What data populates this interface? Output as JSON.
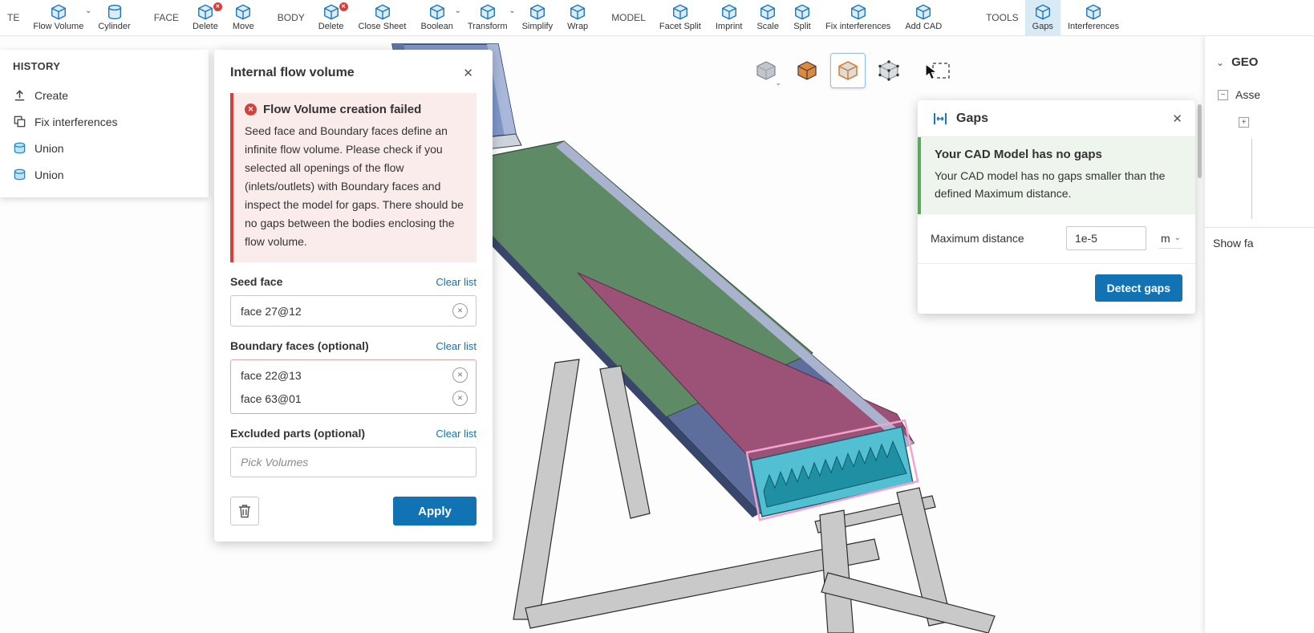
{
  "colors": {
    "accent": "#1173b4",
    "toolbar_icon_blue": "#1a76b8",
    "error_red": "#d4403a",
    "error_bg": "#fbecec",
    "success_green": "#5ba75d",
    "success_bg": "#edf5ec",
    "selected_tool_bg": "#d9eaf7"
  },
  "icons": {
    "close": "✕",
    "chevron_down": "⌄",
    "minus": "−",
    "plus": "+",
    "badge_x": "✕"
  },
  "toolbar": {
    "groups": [
      {
        "label": "TE",
        "items": [
          {
            "label": "Flow Volume"
          },
          {
            "label": "Cylinder"
          }
        ]
      },
      {
        "label": "FACE",
        "items": [
          {
            "label": "Delete"
          },
          {
            "label": "Move"
          }
        ]
      },
      {
        "label": "BODY",
        "items": [
          {
            "label": "Delete"
          },
          {
            "label": "Close Sheet"
          },
          {
            "label": "Boolean"
          },
          {
            "label": "Transform"
          },
          {
            "label": "Simplify"
          },
          {
            "label": "Wrap"
          }
        ]
      },
      {
        "label": "MODEL",
        "items": [
          {
            "label": "Facet Split"
          },
          {
            "label": "Imprint"
          },
          {
            "label": "Scale"
          },
          {
            "label": "Split"
          },
          {
            "label": "Fix interferences"
          },
          {
            "label": "Add CAD"
          }
        ]
      },
      {
        "label": "TOOLS",
        "items": [
          {
            "label": "Gaps"
          },
          {
            "label": "Interferences"
          }
        ]
      }
    ]
  },
  "history": {
    "title": "HISTORY",
    "items": [
      {
        "label": "Create"
      },
      {
        "label": "Fix interferences"
      },
      {
        "label": "Union"
      },
      {
        "label": "Union"
      }
    ]
  },
  "flow_dialog": {
    "title": "Internal flow volume",
    "error": {
      "title": "Flow Volume creation failed",
      "body": "Seed face and Boundary faces define an infinite flow volume. Please check if you selected all openings of the flow (inlets/outlets) with Boundary faces and inspect the model for gaps. There should be no gaps between the bodies enclosing the flow volume."
    },
    "clear_list": "Clear list",
    "seed": {
      "label": "Seed face",
      "chips": [
        "face 27@12"
      ]
    },
    "boundary": {
      "label": "Boundary faces (optional)",
      "chips": [
        "face 22@13",
        "face 63@01"
      ]
    },
    "excluded": {
      "label": "Excluded parts (optional)",
      "placeholder": "Pick Volumes"
    },
    "apply_label": "Apply"
  },
  "gaps_dialog": {
    "title": "Gaps",
    "success": {
      "title": "Your CAD Model has no gaps",
      "body": "Your CAD model has no gaps smaller than the defined Maximum distance."
    },
    "max_distance": {
      "label": "Maximum distance",
      "value": "1e-5",
      "unit": "m"
    },
    "detect_label": "Detect gaps"
  },
  "right_panel": {
    "header": "GEO",
    "tree_item": "Asse",
    "show_label": "Show fa"
  }
}
